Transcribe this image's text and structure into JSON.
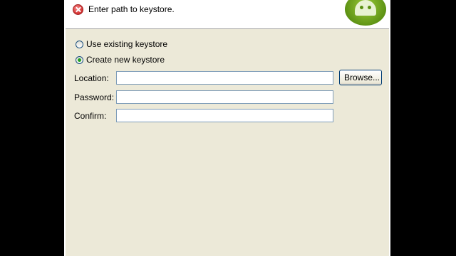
{
  "header": {
    "message": "Enter path to keystore.",
    "error_icon": "error-icon",
    "logo_icon": "android-logo"
  },
  "options": {
    "use_existing": {
      "label": "Use existing keystore",
      "checked": false
    },
    "create_new": {
      "label": "Create new keystore",
      "checked": true
    }
  },
  "form": {
    "location": {
      "label": "Location:",
      "value": ""
    },
    "password": {
      "label": "Password:",
      "value": ""
    },
    "confirm": {
      "label": "Confirm:",
      "value": ""
    },
    "browse_label": "Browse..."
  }
}
